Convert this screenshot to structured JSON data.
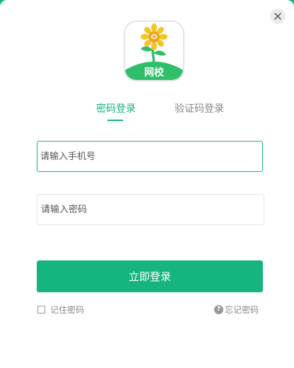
{
  "logo": {
    "badge_text": "网校",
    "icon": "sunflower-logo-icon"
  },
  "close": {
    "icon": "close-icon"
  },
  "tabs": [
    {
      "label": "密码登录",
      "active": true
    },
    {
      "label": "验证码登录",
      "active": false
    }
  ],
  "form": {
    "phone_placeholder": "请输入手机号",
    "phone_value": "",
    "password_placeholder": "请输入密码",
    "password_value": ""
  },
  "login_button": {
    "label": "立即登录"
  },
  "remember": {
    "label": "记住密码",
    "checked": false
  },
  "forgot": {
    "label": "忘记密码",
    "icon": "question-icon"
  },
  "colors": {
    "accent": "#16b57f",
    "text_muted": "#888888",
    "sunflower_petal": "#f7c325"
  }
}
